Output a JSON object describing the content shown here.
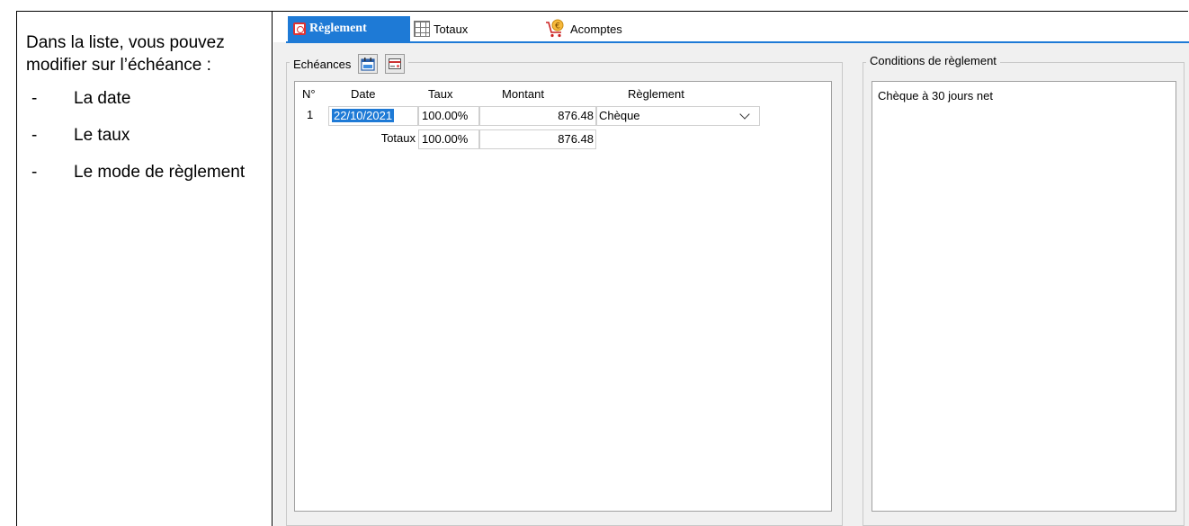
{
  "instructions": {
    "intro": "Dans la liste, vous pouvez modifier sur l’échéance :",
    "bullets": [
      {
        "dash": "-",
        "text": "La date"
      },
      {
        "dash": "-",
        "text": "Le taux"
      },
      {
        "dash": "-",
        "text": "Le mode de règlement"
      }
    ]
  },
  "tabs": {
    "reglement": "Règlement",
    "totaux": "Totaux",
    "acomptes": "Acomptes"
  },
  "echeances": {
    "legend": "Echéances",
    "columns": {
      "num": "N°",
      "date": "Date",
      "taux": "Taux",
      "montant": "Montant",
      "reglement": "Règlement"
    },
    "row": {
      "num": "1",
      "date": "22/10/2021",
      "taux": "100.00%",
      "montant": "876.48",
      "reglement": "Chèque"
    },
    "totaux": {
      "label": "Totaux",
      "taux": "100.00%",
      "montant": "876.48"
    }
  },
  "conditions": {
    "legend": "Conditions de règlement",
    "text": "Chèque à 30 jours net"
  },
  "colors": {
    "accent": "#1e7ad6",
    "panel_bg": "#f0f0f0",
    "icon_red": "#d33"
  }
}
